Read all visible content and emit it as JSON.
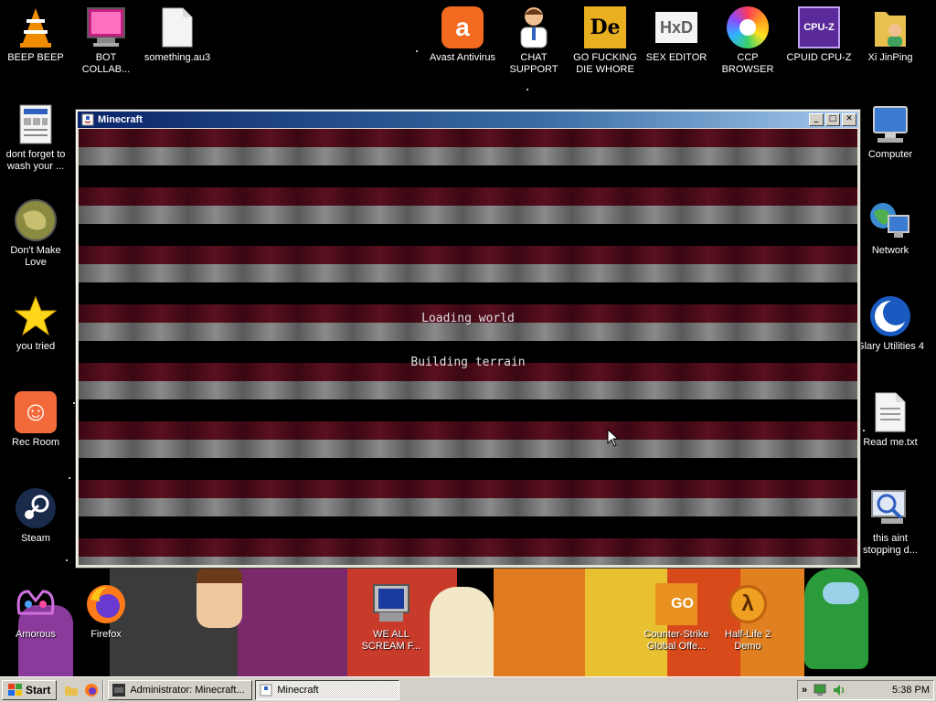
{
  "desktop": {
    "icons": [
      {
        "label": "BEEP BEEP"
      },
      {
        "label": "BOT COLLAB..."
      },
      {
        "label": "something.au3"
      },
      {
        "label": "Avast Antivirus"
      },
      {
        "label": "CHAT SUPPORT"
      },
      {
        "label": "GO FUCKING DIE WHORE"
      },
      {
        "label": "SEX EDITOR"
      },
      {
        "label": "CCP BROWSER"
      },
      {
        "label": "CPUID CPU-Z"
      },
      {
        "label": "Xi JinPing"
      },
      {
        "label": "dont forget to wash your ..."
      },
      {
        "label": "Don't Make Love"
      },
      {
        "label": "you tried"
      },
      {
        "label": "Rec Room"
      },
      {
        "label": "Steam"
      },
      {
        "label": "Computer"
      },
      {
        "label": "Network"
      },
      {
        "label": "Glary Utilities 4"
      },
      {
        "label": "Read me.txt"
      },
      {
        "label": "this aint stopping d..."
      },
      {
        "label": "Amorous"
      },
      {
        "label": "Firefox"
      },
      {
        "label": "WE ALL SCREAM F..."
      },
      {
        "label": "Counter-Strike Global Offe..."
      },
      {
        "label": "Half-Life 2 Demo"
      }
    ],
    "icon_glyphs": {
      "avast": "a",
      "die": "De",
      "hxd": "HxD",
      "cpuz": "CPU-Z",
      "csgo": "GO",
      "hl2": "λ",
      "rec_room": "☺"
    }
  },
  "window": {
    "title": "Minecraft",
    "buttons": {
      "minimize": "_",
      "maximize": "□",
      "close": "✕"
    },
    "status_line1": "Loading world",
    "status_line2": "Building terrain"
  },
  "taskbar": {
    "start_label": "Start",
    "tasks": [
      {
        "label": "Administrator: Minecraft..."
      },
      {
        "label": "Minecraft"
      }
    ],
    "tray_arrow": "»",
    "clock": "5:38 PM"
  }
}
